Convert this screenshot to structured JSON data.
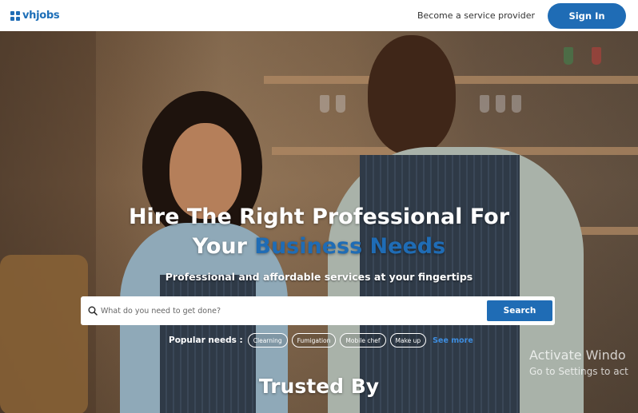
{
  "header": {
    "logo_text": "vhjobs",
    "provider_link": "Become a service provider",
    "signin_label": "Sign In"
  },
  "hero": {
    "title_line1": "Hire The Right Professional For",
    "title_line2_plain": "Your ",
    "title_line2_accent": "Business Needs",
    "subtitle": "Professional and affordable services at your fingertips"
  },
  "search": {
    "placeholder": "What do you need to get done?",
    "button_label": "Search"
  },
  "popular": {
    "label": "Popular needs :",
    "chips": [
      "Clearning",
      "Fumigation",
      "Mobile chef",
      "Make up"
    ],
    "see_more": "See more"
  },
  "trusted": {
    "heading": "Trusted By"
  },
  "watermark": {
    "line1": "Activate Windo",
    "line2": "Go to Settings to act"
  },
  "colors": {
    "brand": "#1f6cb5",
    "accent_text": "#1f6cb5",
    "link": "#3d8de0"
  }
}
